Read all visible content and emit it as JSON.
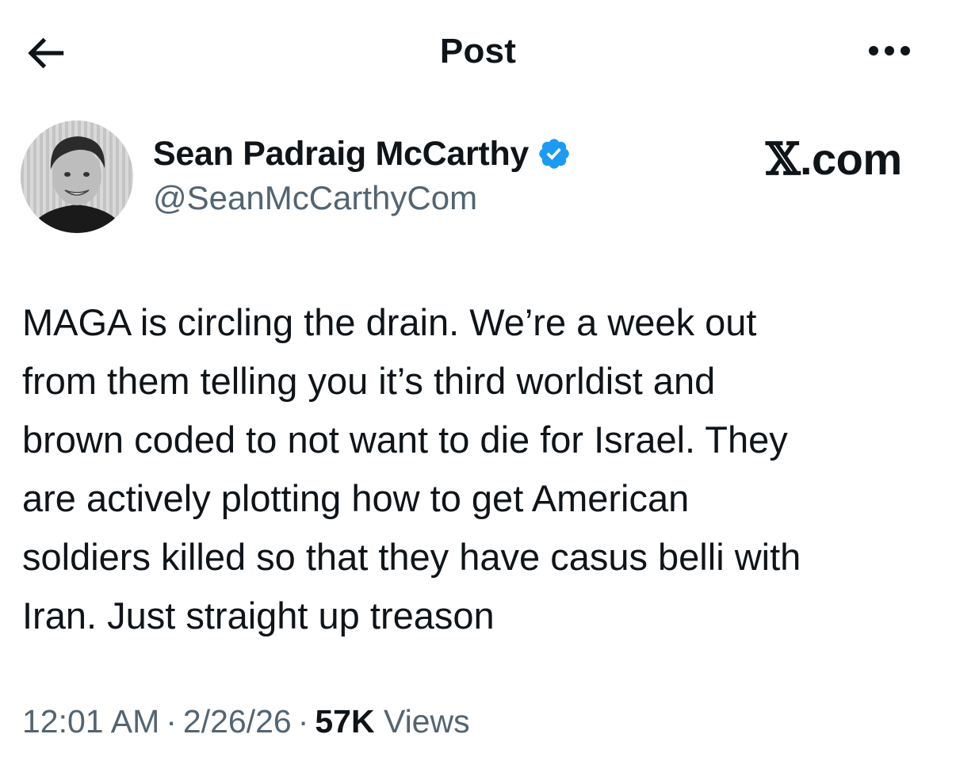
{
  "header": {
    "title": "Post",
    "back_icon": "arrow-left-icon",
    "more_icon": "more-horizontal-icon"
  },
  "author": {
    "display_name": "Sean Padraig McCarthy",
    "handle": "@SeanMcCarthyCom",
    "verified": true,
    "verified_color": "#1d9bf0",
    "avatar_icon": "profile-photo"
  },
  "watermark": {
    "x_glyph": "𝕏",
    "suffix": ".com"
  },
  "tweet": {
    "lines": [
      "MAGA is circling the drain. We’re a week out",
      "from them telling you it’s third worldist and",
      "brown coded to not want to die for Israel. They",
      "are actively plotting how to get American",
      "soldiers killed so that they have casus belli with",
      "Iran. Just straight up treason"
    ]
  },
  "meta": {
    "time": "12:01 AM",
    "date": "2/26/26",
    "separator": "·",
    "views_count": "57K",
    "views_label": "Views"
  },
  "colors": {
    "text": "#0f1419",
    "secondary": "#536471",
    "accent": "#1d9bf0",
    "background": "#ffffff"
  }
}
